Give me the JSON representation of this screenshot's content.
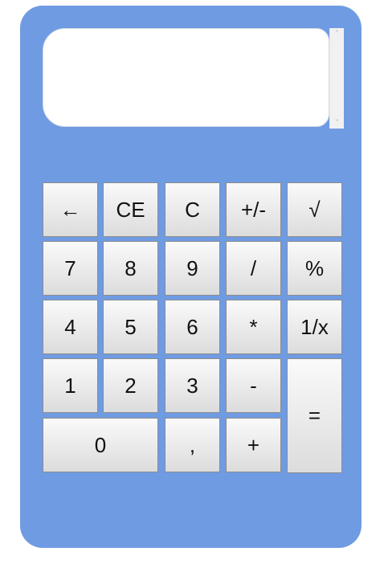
{
  "display": {
    "value": ""
  },
  "scrollbar": {
    "up_glyph": "˄",
    "down_glyph": "˅"
  },
  "keys": {
    "backspace": "←",
    "ce": "CE",
    "c": "C",
    "plus_minus": "+/-",
    "sqrt": "√",
    "seven": "7",
    "eight": "8",
    "nine": "9",
    "divide": "/",
    "percent": "%",
    "four": "4",
    "five": "5",
    "six": "6",
    "multiply": "*",
    "reciprocal": "1/x",
    "one": "1",
    "two": "2",
    "three": "3",
    "minus": "-",
    "equals": "=",
    "zero": "0",
    "comma": ",",
    "plus": "+"
  },
  "colors": {
    "body": "#6f9be3",
    "display": "#ffffff",
    "key_top": "#fafafa",
    "key_bottom": "#dcdcdc"
  }
}
